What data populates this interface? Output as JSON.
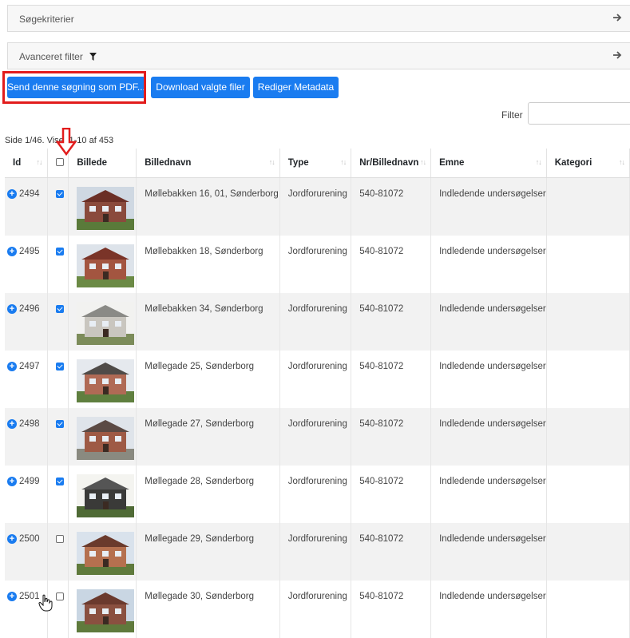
{
  "panels": {
    "search_criteria": "Søgekriterier",
    "advanced_filter": "Avanceret filter"
  },
  "buttons": {
    "send_pdf": "Send denne søgning som PDF...",
    "download": "Download valgte filer",
    "edit_metadata": "Rediger Metadata"
  },
  "filter": {
    "label": "Filter",
    "value": ""
  },
  "page_info": "Side 1/46. Viser 1-10 af 453",
  "columns": {
    "id": "Id",
    "image": "Billede",
    "name": "Billednavn",
    "type": "Type",
    "nr": "Nr/Billednavn",
    "subject": "Emne",
    "category": "Kategori"
  },
  "sort_glyph": "↑↓",
  "rows": [
    {
      "id": "2494",
      "checked": true,
      "name": "Møllebakken 16, 01, Sønderborg",
      "type": "Jordforurening",
      "nr": "540-81072",
      "subject": "Indledende undersøgelser",
      "category": ""
    },
    {
      "id": "2495",
      "checked": true,
      "name": "Møllebakken 18, Sønderborg",
      "type": "Jordforurening",
      "nr": "540-81072",
      "subject": "Indledende undersøgelser",
      "category": ""
    },
    {
      "id": "2496",
      "checked": true,
      "name": "Møllebakken 34, Sønderborg",
      "type": "Jordforurening",
      "nr": "540-81072",
      "subject": "Indledende undersøgelser",
      "category": ""
    },
    {
      "id": "2497",
      "checked": true,
      "name": "Møllegade 25, Sønderborg",
      "type": "Jordforurening",
      "nr": "540-81072",
      "subject": "Indledende undersøgelser",
      "category": ""
    },
    {
      "id": "2498",
      "checked": true,
      "name": "Møllegade 27, Sønderborg",
      "type": "Jordforurening",
      "nr": "540-81072",
      "subject": "Indledende undersøgelser",
      "category": ""
    },
    {
      "id": "2499",
      "checked": true,
      "name": "Møllegade 28, Sønderborg",
      "type": "Jordforurening",
      "nr": "540-81072",
      "subject": "Indledende undersøgelser",
      "category": ""
    },
    {
      "id": "2500",
      "checked": false,
      "name": "Møllegade 29, Sønderborg",
      "type": "Jordforurening",
      "nr": "540-81072",
      "subject": "Indledende undersøgelser",
      "category": ""
    },
    {
      "id": "2501",
      "checked": false,
      "name": "Møllegade 30, Sønderborg",
      "type": "Jordforurening",
      "nr": "540-81072",
      "subject": "Indledende undersøgelser",
      "category": ""
    }
  ],
  "colors": {
    "accent": "#1a7cf0",
    "highlight": "#e21c1c"
  }
}
